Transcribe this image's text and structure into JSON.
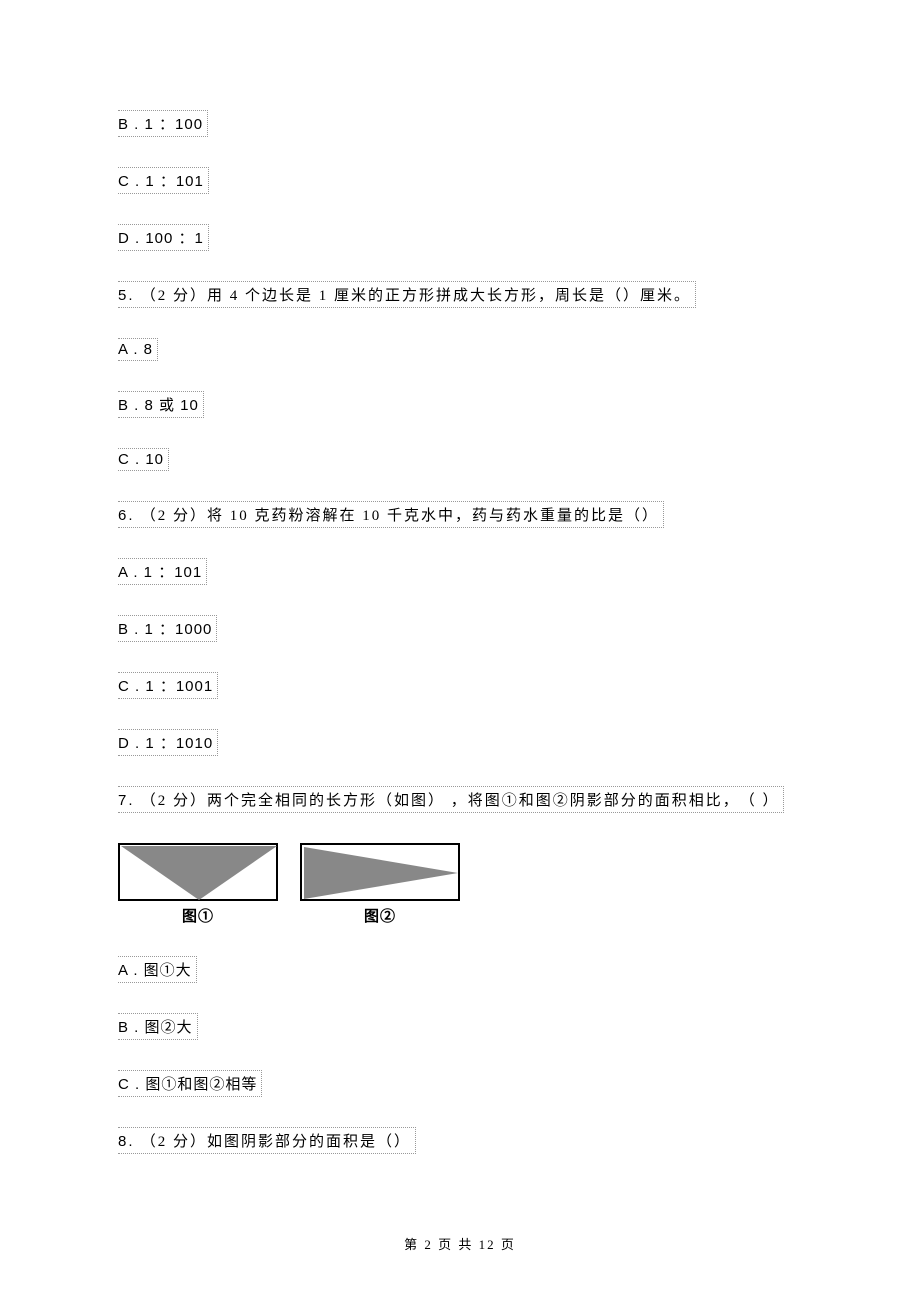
{
  "options_top": {
    "b": "B . 1  ：100",
    "c": "C . 1  ：101",
    "d": "D . 100  ：1"
  },
  "q5": {
    "prefix_num": "5. ",
    "points": "（2 分）",
    "text_a": "用  4 个边长是   1 厘米的正方形拼成大长方形，周长是（",
    "blank": "            ",
    "text_b": "）厘米。",
    "opt_a": "A . 8",
    "opt_b": "B . 8   或 10",
    "opt_c": "C . 10"
  },
  "q6": {
    "prefix_num": "6. ",
    "points": "（2 分）",
    "text_a": "将  10 克药粉溶解在   10 千克水中，药与药水重量的比是（",
    "blank": "           ",
    "text_b": "）",
    "opt_a": "A . 1   ：101",
    "opt_b": "B . 1   ：1000",
    "opt_c": "C . 1   ：1001",
    "opt_d": "D . 1   ：1010"
  },
  "q7": {
    "prefix_num": "7. ",
    "points": "（2 分）",
    "text_a": "两个完全相同的长方形（如图）    ，将图①和图②阴影部分的面积相比，",
    "blank": "     ",
    "text_b": "（        ）",
    "img1_label": "图①",
    "img2_label": "图②",
    "opt_a": "A .   图①大",
    "opt_b": "B .   图②大",
    "opt_c": "C .   图①和图②相等"
  },
  "q8": {
    "prefix_num": "8. ",
    "points": "（2 分）",
    "text_a": "如图阴影部分的面积是（",
    "blank": "           ",
    "text_b": "）"
  },
  "footer": "第  2  页  共  12  页"
}
